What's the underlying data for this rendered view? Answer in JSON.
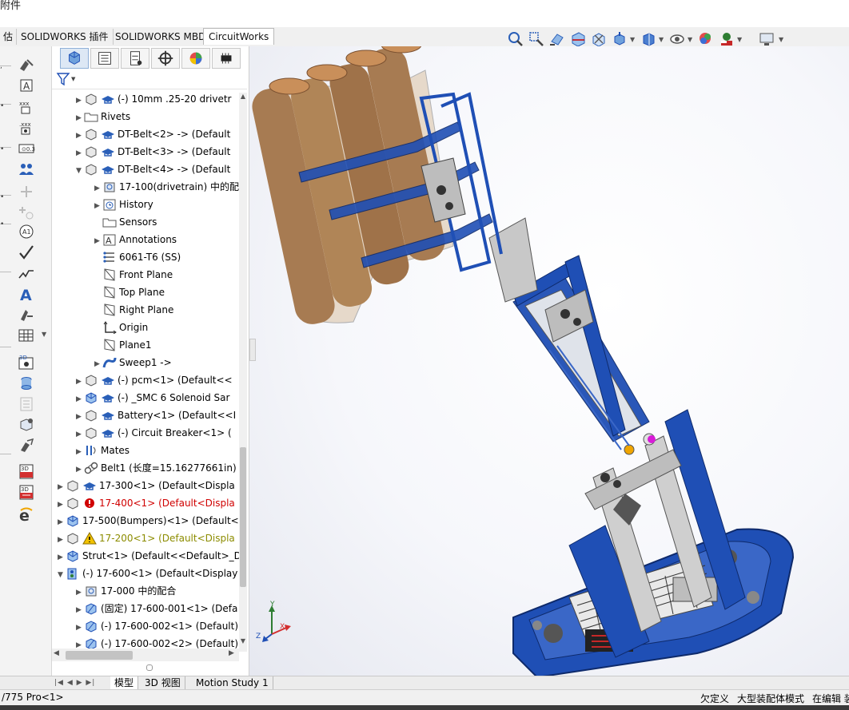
{
  "title_fragment": "附件",
  "command_tabs": [
    {
      "label": "估"
    },
    {
      "label": "SOLIDWORKS 插件"
    },
    {
      "label": "SOLIDWORKS MBD"
    },
    {
      "label": "CircuitWorks"
    }
  ],
  "tree": [
    {
      "text": "(-) 10mm .25-20 drivetr"
    },
    {
      "text": "Rivets"
    },
    {
      "text": "DT-Belt<2> -> (Default"
    },
    {
      "text": "DT-Belt<3> -> (Default"
    },
    {
      "text": "DT-Belt<4> -> (Default"
    },
    {
      "text": "17-100(drivetrain) 中的配"
    },
    {
      "text": "History"
    },
    {
      "text": "Sensors"
    },
    {
      "text": "Annotations"
    },
    {
      "text": "6061-T6 (SS)"
    },
    {
      "text": "Front Plane"
    },
    {
      "text": "Top Plane"
    },
    {
      "text": "Right Plane"
    },
    {
      "text": "Origin"
    },
    {
      "text": "Plane1"
    },
    {
      "text": "Sweep1 ->"
    },
    {
      "text": "(-) pcm<1> (Default<<"
    },
    {
      "text": "(-) _SMC 6 Solenoid Sar"
    },
    {
      "text": "Battery<1> (Default<<I"
    },
    {
      "text": "(-) Circuit Breaker<1> ("
    },
    {
      "text": "Mates"
    },
    {
      "text": "Belt1 (长度=15.16277661in)"
    },
    {
      "text": "17-300<1> (Default<Displa"
    },
    {
      "text": "17-400<1> (Default<Displa"
    },
    {
      "text": "17-500(Bumpers)<1> (Default<"
    },
    {
      "text": "17-200<1> (Default<Displa"
    },
    {
      "text": "Strut<1> (Default<<Default>_D"
    },
    {
      "text": "(-) 17-600<1> (Default<Display"
    },
    {
      "text": "17-000 中的配合"
    },
    {
      "text": "(固定) 17-600-001<1> (Defa"
    },
    {
      "text": "(-) 17-600-002<1> (Default)"
    },
    {
      "text": "(-) 17-600-002<2> (Default)"
    }
  ],
  "bottom_tabs": [
    {
      "label": "模型"
    },
    {
      "label": "3D 视图"
    },
    {
      "label": "Motion Study 1"
    }
  ],
  "status": {
    "left": "/775 Pro<1>",
    "state": "欠定义",
    "mode": "大型装配体模式",
    "edit": "在编辑 装"
  },
  "triad": {
    "x": "X",
    "y": "Y",
    "z": "Z"
  },
  "colors": {
    "accent": "#2a5fb8",
    "error": "#d00000",
    "warning": "#8c8c00",
    "robot_blue": "#1f4fb5",
    "wood": "#a77b52"
  }
}
